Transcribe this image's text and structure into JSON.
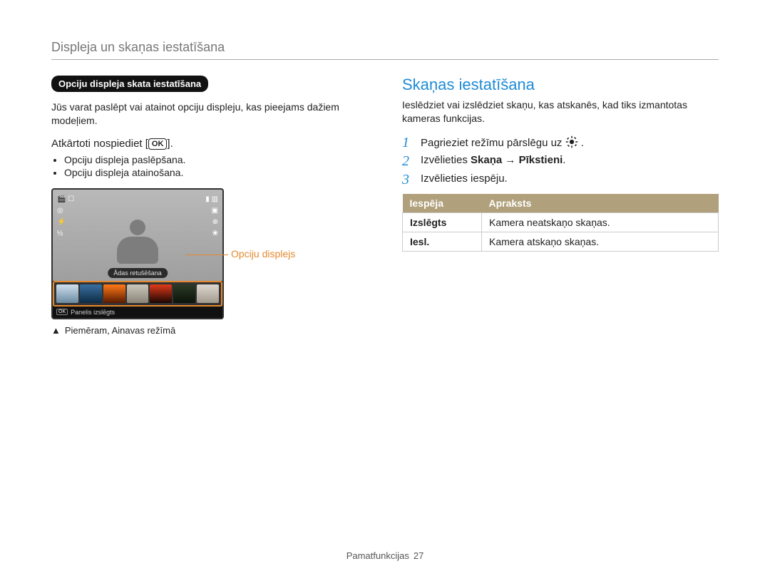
{
  "header": {
    "title": "Displeja un skaņas iestatīšana"
  },
  "left": {
    "chip": "Opciju displeja skata iestatīšana",
    "intro": "Jūs varat paslēpt vai atainot opciju displeju, kas pieejams dažiem modeļiem.",
    "subhead_pre": "Atkārtoti nospiediet [",
    "subhead_btn": "OK",
    "subhead_post": "].",
    "bullets": [
      "Opciju displeja paslēpšana.",
      "Opciju displeja atainošana."
    ],
    "lcd": {
      "retouch": "Ādas retušēšana",
      "panel_off": "Panelis izslēgts",
      "ok": "OK"
    },
    "opciju_label": "Opciju displejs",
    "caption_symbol": "▲",
    "caption": "Piemēram, Ainavas režīmā"
  },
  "right": {
    "title": "Skaņas iestatīšana",
    "intro": "Ieslēdziet vai izslēdziet skaņu, kas atskanēs, kad tiks izmantotas kameras funkcijas.",
    "steps": {
      "s1_num": "1",
      "s1_pre": "Pagrieziet režīmu pārslēgu uz ",
      "s1_post": " .",
      "s2_num": "2",
      "s2_pre": "Izvēlieties ",
      "s2_b1": "Skaņa",
      "s2_arrow": " → ",
      "s2_b2": "Pīkstieni",
      "s2_post": ".",
      "s3_num": "3",
      "s3_text": "Izvēlieties iespēju."
    },
    "table": {
      "h1": "Iespēja",
      "h2": "Apraksts",
      "r1k": "Izslēgts",
      "r1v": "Kamera neatskaņo skaņas.",
      "r2k": "Iesl.",
      "r2v": "Kamera atskaņo skaņas."
    }
  },
  "footer": {
    "label": "Pamatfunkcijas",
    "page": "27"
  }
}
